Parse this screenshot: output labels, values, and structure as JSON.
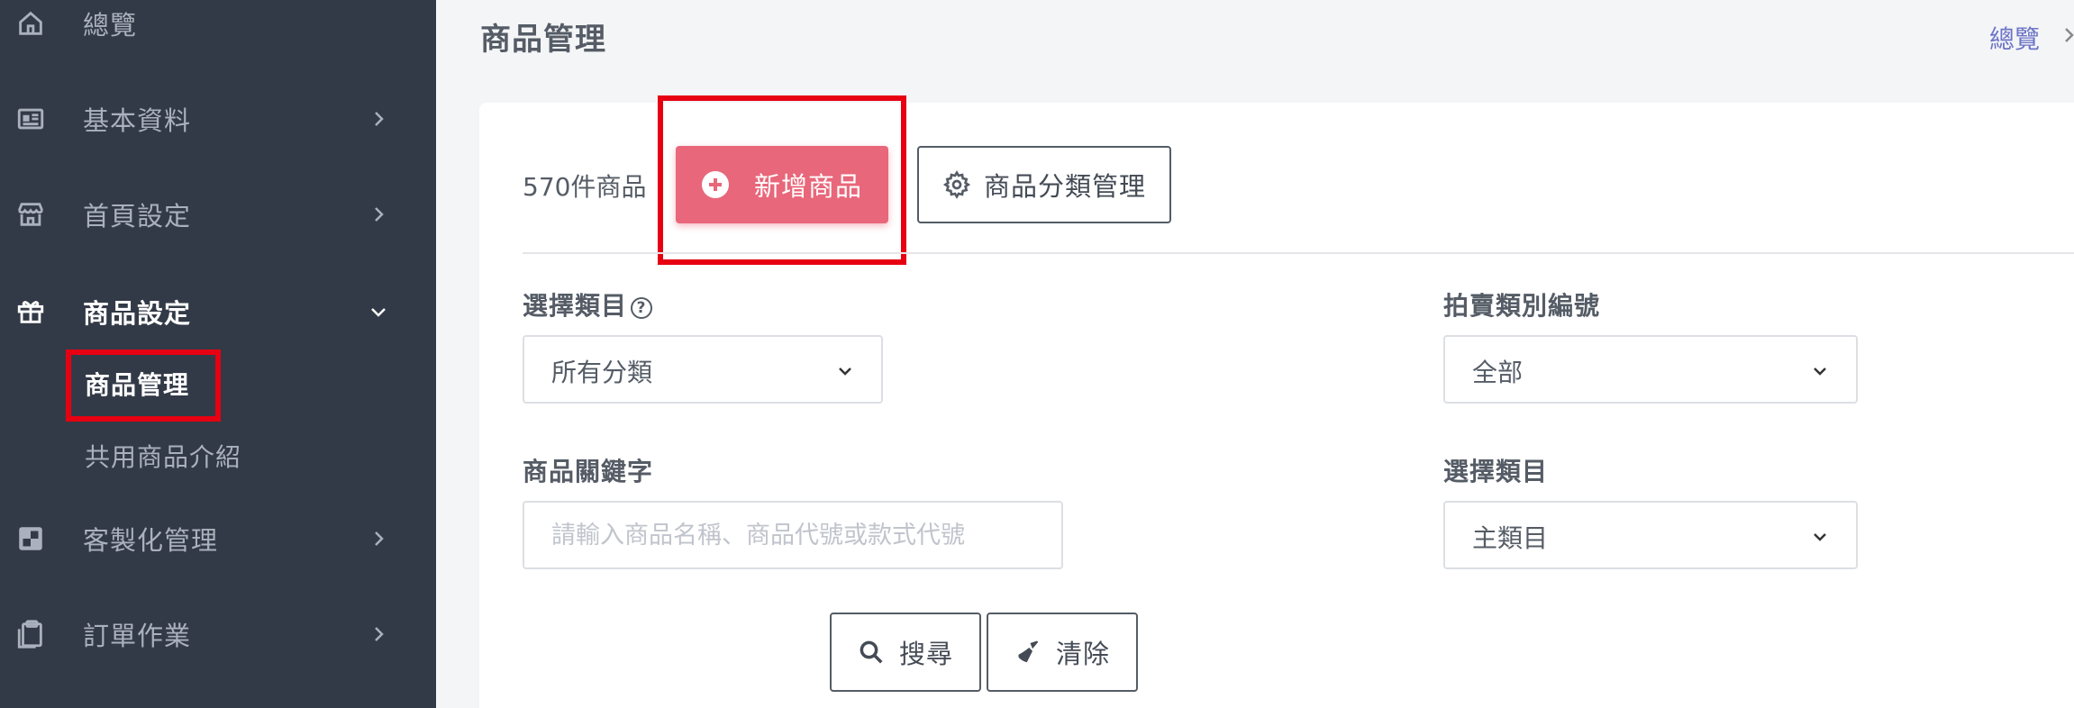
{
  "sidebar": {
    "items": [
      {
        "label": "總覽",
        "icon": "home-icon"
      },
      {
        "label": "基本資料",
        "icon": "id-card-icon"
      },
      {
        "label": "首頁設定",
        "icon": "store-icon"
      },
      {
        "label": "商品設定",
        "icon": "gift-icon"
      },
      {
        "label": "客製化管理",
        "icon": "customize-icon"
      },
      {
        "label": "訂單作業",
        "icon": "clipboard-icon"
      }
    ],
    "sub_items": [
      {
        "label": "商品管理"
      },
      {
        "label": "共用商品介紹"
      }
    ]
  },
  "header": {
    "title": "商品管理",
    "breadcrumb": "總覽"
  },
  "toolbar": {
    "count": "570件商品",
    "add_label": "新增商品",
    "category_label": "商品分類管理"
  },
  "filters": {
    "category_label": "選擇類目",
    "category_help": "?",
    "category_value": "所有分類",
    "auction_label": "拍賣類別編號",
    "auction_value": "全部",
    "keyword_label": "商品關鍵字",
    "keyword_placeholder": "請輸入商品名稱、商品代號或款式代號",
    "main_category_label": "選擇類目",
    "main_category_value": "主類目"
  },
  "actions": {
    "search_label": "搜尋",
    "clear_label": "清除"
  },
  "colors": {
    "sidebar_bg": "#333a47",
    "accent": "#e8677a",
    "highlight": "#e60012",
    "link": "#6b74c6"
  }
}
